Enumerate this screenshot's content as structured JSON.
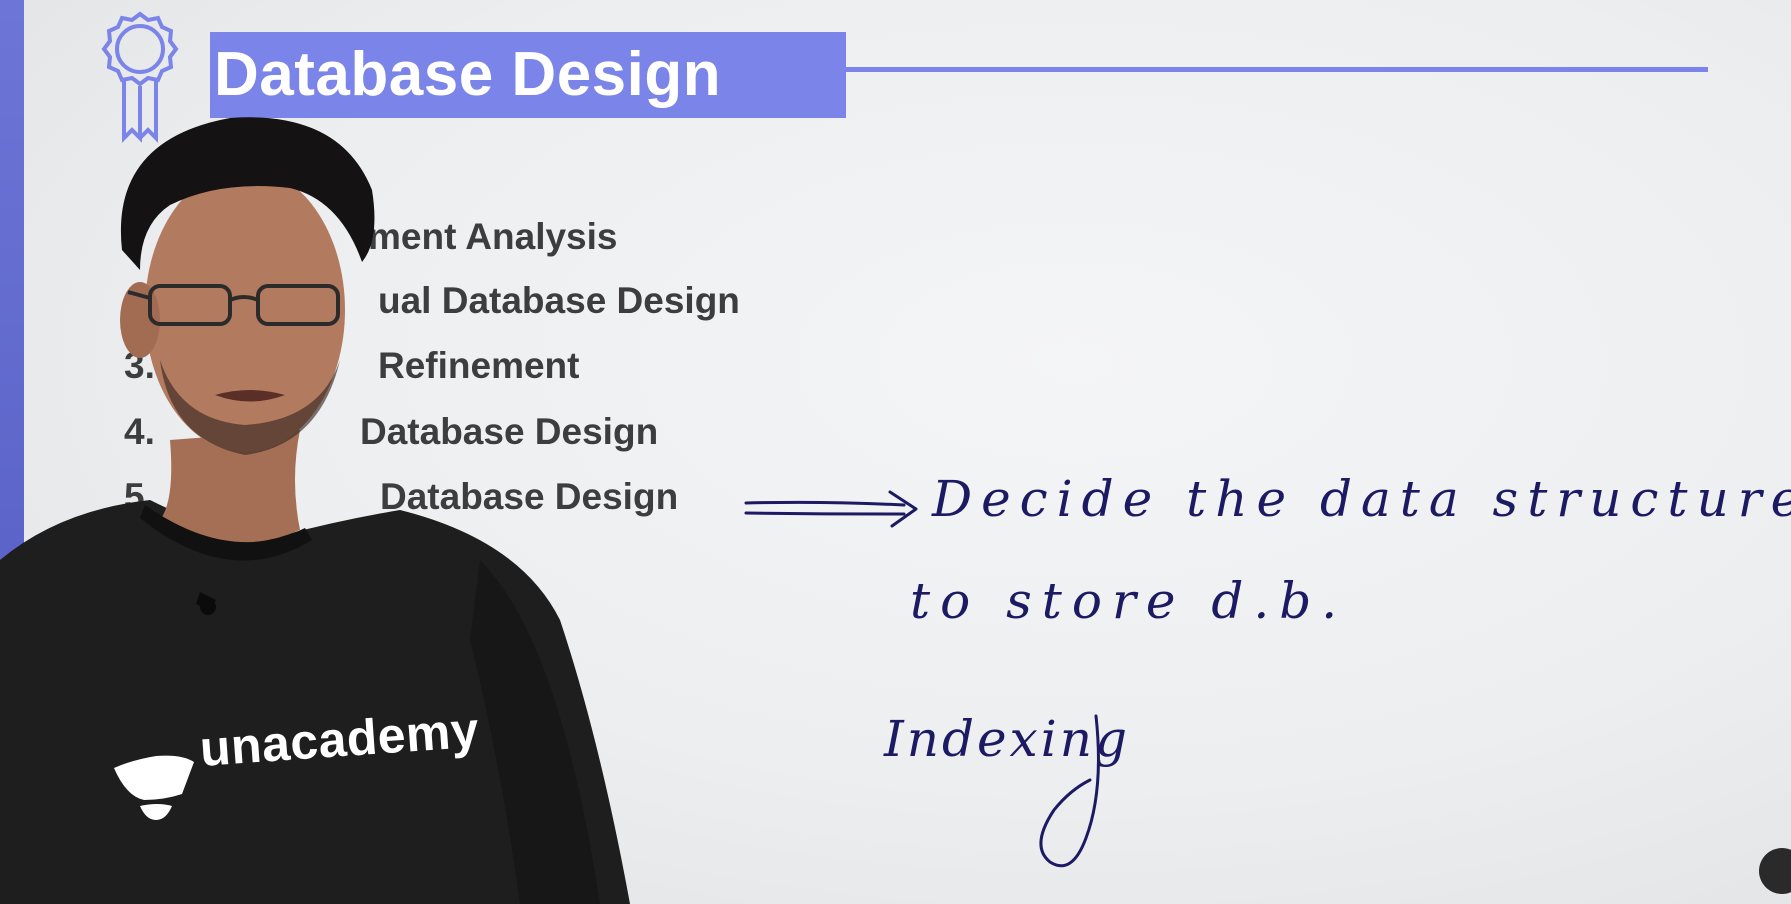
{
  "slide": {
    "title": "Database Design",
    "steps": [
      {
        "num": "",
        "label": "ment Analysis"
      },
      {
        "num": "",
        "label": "ual Database Design"
      },
      {
        "num": "3.",
        "label": "Refinement"
      },
      {
        "num": "4.",
        "label": "Database Design"
      },
      {
        "num": "5.",
        "label": "Database Design"
      }
    ],
    "handwriting": {
      "line1": "Decide the data structures",
      "line2": "to store d.b.",
      "line3": "Indexing"
    }
  },
  "presenter": {
    "shirt_brand": "unacademy"
  },
  "colors": {
    "accent": "#7b84e8",
    "ink": "#1b1a63",
    "text": "#3d3d3d",
    "shirt": "#1e1e1e"
  },
  "icons": {
    "badge": "award-ribbon-icon",
    "arrow": "double-arrow-right-icon",
    "logo": "unacademy-logo-icon"
  }
}
